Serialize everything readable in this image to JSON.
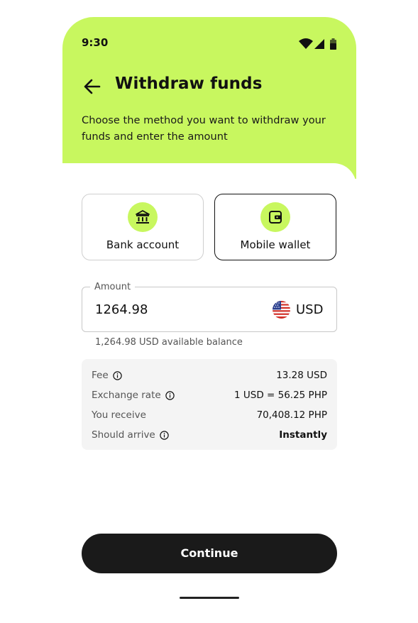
{
  "status_bar": {
    "time": "9:30"
  },
  "header": {
    "title": "Withdraw funds",
    "subtitle": "Choose the method you want to withdraw your funds and enter the amount",
    "accent_color": "#c8f75f"
  },
  "methods": [
    {
      "label": "Bank account",
      "icon": "bank-icon",
      "selected": false
    },
    {
      "label": "Mobile wallet",
      "icon": "wallet-icon",
      "selected": true
    }
  ],
  "amount": {
    "label": "Amount",
    "value": "1264.98",
    "currency": "USD",
    "currency_icon": "us-flag-icon",
    "hint": "1,264.98 USD available balance"
  },
  "summary": [
    {
      "label": "Fee",
      "value": "13.28 USD",
      "info": true
    },
    {
      "label": "Exchange rate",
      "value": "1 USD = 56.25 PHP",
      "info": true
    },
    {
      "label": "You receive",
      "value": "70,408.12 PHP",
      "info": false
    },
    {
      "label": "Should arrive",
      "value": "Instantly",
      "info": true
    }
  ],
  "actions": {
    "continue_label": "Continue"
  }
}
